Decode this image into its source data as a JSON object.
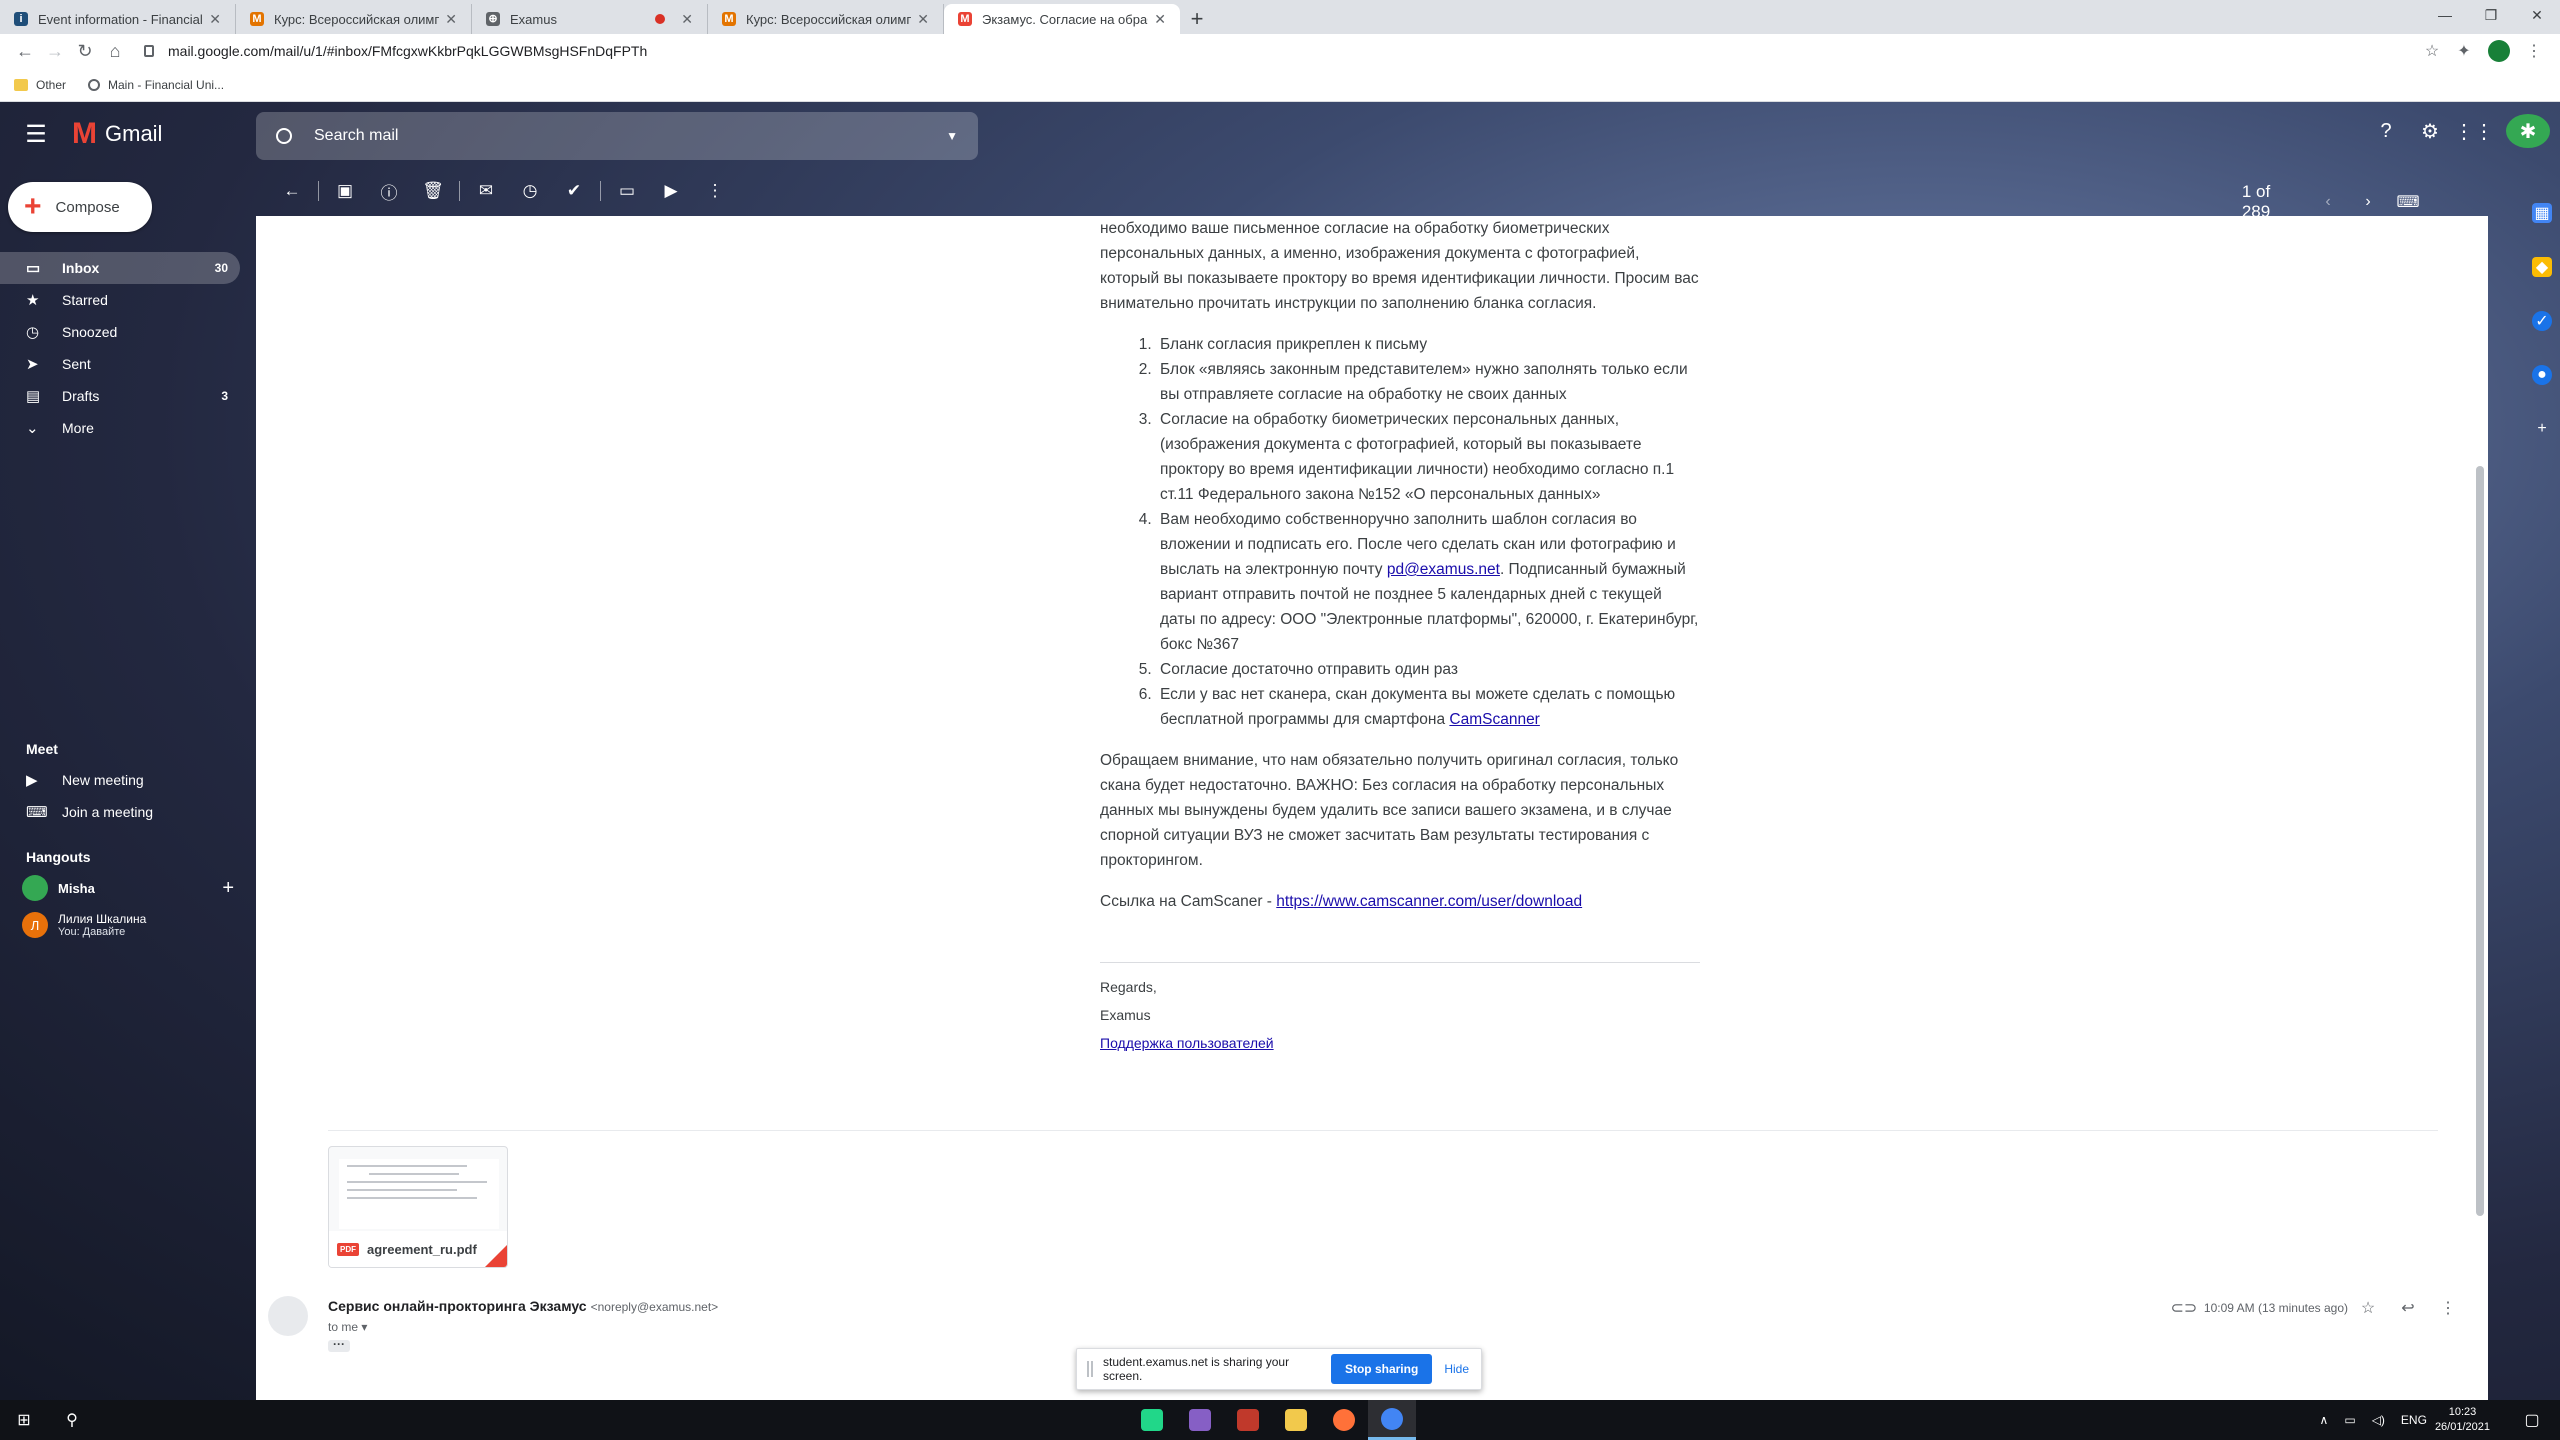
{
  "browser": {
    "tabs": [
      {
        "title": "Event information - Financial Uni",
        "favicon_color": "#1f4e79",
        "favicon_glyph": "i"
      },
      {
        "title": "Курс: Всероссийская олимпиада",
        "favicon_color": "#e37400",
        "favicon_glyph": "M"
      },
      {
        "title": "Examus",
        "favicon_color": "#5f6368",
        "favicon_glyph": "⊕",
        "recording": true
      },
      {
        "title": "Курс: Всероссийская олимпиада",
        "favicon_color": "#e37400",
        "favicon_glyph": "M"
      },
      {
        "title": "Экзамус. Согласие на обработк",
        "favicon_color": "#ea4335",
        "favicon_glyph": "M",
        "active": true
      }
    ],
    "url": "mail.google.com/mail/u/1/#inbox/FMfcgxwKkbrPqkLGGWBMsgHSFnDqFPTh",
    "bookmarks": [
      "Other",
      "Main - Financial Uni..."
    ]
  },
  "gmail": {
    "brand": "Gmail",
    "search_placeholder": "Search mail",
    "compose_label": "Compose",
    "nav": [
      {
        "label": "Inbox",
        "count": "30",
        "icon": "inbox-icon",
        "glyph": "▭",
        "active": true
      },
      {
        "label": "Starred",
        "count": "",
        "icon": "star-icon",
        "glyph": "★"
      },
      {
        "label": "Snoozed",
        "count": "",
        "icon": "clock-icon",
        "glyph": "◷"
      },
      {
        "label": "Sent",
        "count": "",
        "icon": "send-icon",
        "glyph": "➤"
      },
      {
        "label": "Drafts",
        "count": "3",
        "icon": "draft-icon",
        "glyph": "▤"
      },
      {
        "label": "More",
        "count": "",
        "icon": "chevron-down-icon",
        "glyph": "⌄"
      }
    ],
    "meet": {
      "heading": "Meet",
      "new_meeting": "New meeting",
      "join_meeting": "Join a meeting"
    },
    "hangouts": {
      "heading": "Hangouts",
      "user": "Misha",
      "contact_name": "Лилия Шкалина",
      "contact_status": "You: Давайте",
      "contact_initial": "Л"
    },
    "pager": {
      "count": "1 of 289"
    }
  },
  "email": {
    "intro": "необходимо ваше письменное согласие на обработку биометрических персональных данных, а именно, изображения документа с фотографией, который вы показываете проктору во время идентификации личности. Просим вас внимательно прочитать инструкции по заполнению бланка согласия.",
    "items": [
      {
        "text": "Бланк согласия прикреплен к письму"
      },
      {
        "text": "Блок «являясь законным представителем» нужно заполнять только если вы отправляете согласие на обработку не своих данных"
      },
      {
        "text": "Согласие на обработку биометрических персональных данных, (изображения документа с фотографией, который вы показываете проктору во время идентификации личности) необходимо согласно п.1 ст.11 Федерального закона №152 «О персональных данных»"
      },
      {
        "pre": "Вам необходимо собственноручно заполнить шаблон согласия во вложении и подписать его. После чего сделать скан или фотографию и выслать на электронную почту ",
        "link": "pd@examus.net",
        "post": ". Подписанный бумажный вариант отправить почтой не позднее 5 календарных дней с текущей даты по адресу: ООО \"Электронные платформы\", 620000, г. Екатеринбург, бокс №367"
      },
      {
        "text": "Согласие достаточно отправить один раз"
      },
      {
        "pre": "Если у вас нет сканера, скан документа вы можете сделать с помощью бесплатной программы для смартфона ",
        "link": "CamScanner",
        "post": ""
      }
    ],
    "notice": "Обращаем внимание, что нам обязательно получить оригинал согласия, только скана будет недостаточно. ВАЖНО: Без согласия на обработку персональных данных мы вынуждены будем удалить все записи вашего экзамена, и в случае спорной ситуации ВУЗ не сможет засчитать Вам результаты тестирования с прокторингом.",
    "camscanner_label": "Ссылка на CamScaner - ",
    "camscanner_url": "https://www.camscanner.com/user/download",
    "regards": "Regards,",
    "signature": "Examus",
    "support_link": "Поддержка пользователей",
    "attachment_name": "agreement_ru.pdf",
    "attachment_badge": "PDF"
  },
  "next_message": {
    "sender": "Сервис онлайн-прокторинга Экзамус",
    "sender_email": "<noreply@examus.net>",
    "to": "to me",
    "time": "10:09 AM (13 minutes ago)"
  },
  "sharebar": {
    "text": "student.examus.net is sharing your screen.",
    "stop": "Stop sharing",
    "hide": "Hide"
  },
  "taskbar": {
    "lang": "ENG",
    "time": "10:23",
    "date": "26/01/2021",
    "apps": [
      {
        "name": "pycharm-icon",
        "color": "#21d789"
      },
      {
        "name": "visual-studio-icon",
        "color": "#865fc5"
      },
      {
        "name": "settings-app-icon",
        "color": "#c0392b"
      },
      {
        "name": "file-explorer-icon",
        "color": "#f2c94c"
      },
      {
        "name": "firefox-icon",
        "color": "#ff7139"
      },
      {
        "name": "chrome-icon",
        "color": "#4285f4",
        "active": true
      }
    ]
  }
}
